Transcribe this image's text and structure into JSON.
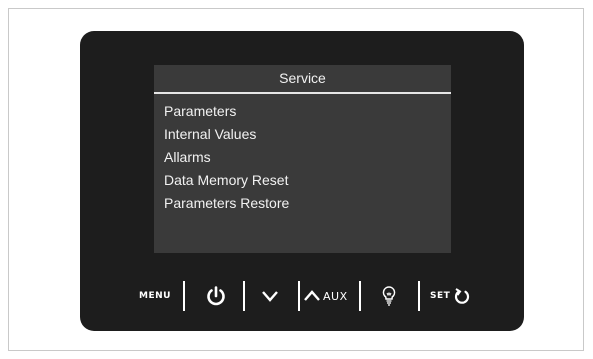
{
  "screen": {
    "title": "Service",
    "items": [
      "Parameters",
      "Internal Values",
      "Allarms",
      "Data Memory Reset",
      "Parameters Restore"
    ]
  },
  "controls": {
    "menu_label": "MENU",
    "aux_label": "AUX",
    "set_label": "SET",
    "icons": [
      "power-icon",
      "down-arrow-icon",
      "up-arrow-icon",
      "light-bulb-icon",
      "rotate-icon"
    ]
  },
  "colors": {
    "device_body": "#1d1d1d",
    "screen_background": "#3a3a3a",
    "screen_text": "#f2f2f2"
  }
}
